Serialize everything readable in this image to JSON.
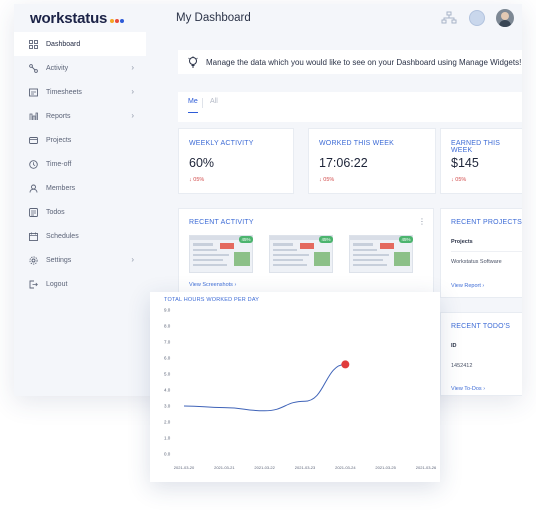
{
  "app": {
    "logo_text": "workstatus",
    "logo_dot_colors": [
      "#f5a623",
      "#e94b3c",
      "#2d5bd7"
    ],
    "page_title": "My Dashboard"
  },
  "sidebar": {
    "items": [
      {
        "label": "Dashboard",
        "icon": "dashboard-icon",
        "active": true,
        "chevron": false
      },
      {
        "label": "Activity",
        "icon": "activity-icon",
        "active": false,
        "chevron": true
      },
      {
        "label": "Timesheets",
        "icon": "timesheets-icon",
        "active": false,
        "chevron": true
      },
      {
        "label": "Reports",
        "icon": "reports-icon",
        "active": false,
        "chevron": true
      },
      {
        "label": "Projects",
        "icon": "projects-icon",
        "active": false,
        "chevron": false
      },
      {
        "label": "Time-off",
        "icon": "time-off-icon",
        "active": false,
        "chevron": false
      },
      {
        "label": "Members",
        "icon": "members-icon",
        "active": false,
        "chevron": false
      },
      {
        "label": "Todos",
        "icon": "todos-icon",
        "active": false,
        "chevron": false
      },
      {
        "label": "Schedules",
        "icon": "schedules-icon",
        "active": false,
        "chevron": false
      },
      {
        "label": "Settings",
        "icon": "settings-icon",
        "active": false,
        "chevron": true
      },
      {
        "label": "Logout",
        "icon": "logout-icon",
        "active": false,
        "chevron": false
      }
    ]
  },
  "banner": {
    "text": "Manage the data which you would like to see on your Dashboard using Manage Widgets!"
  },
  "tabs": {
    "me": "Me",
    "all": "All"
  },
  "stats": [
    {
      "label": "WEEKLY ACTIVITY",
      "value": "60%",
      "delta": "05%"
    },
    {
      "label": "WORKED THIS WEEK",
      "value": "17:06:22",
      "delta": "05%"
    },
    {
      "label": "EARNED THIS WEEK",
      "value": "$145",
      "delta": "05%"
    }
  ],
  "recent_activity": {
    "title": "RECENT ACTIVITY",
    "badges": [
      "45%",
      "45%",
      "45%"
    ],
    "view_link": "View Screenshots"
  },
  "recent_projects": {
    "title": "RECENT PROJECTS",
    "column": "Projects",
    "row": "Workstatus Software",
    "view_link": "View Report"
  },
  "recent_todos": {
    "title": "RECENT TODO'S",
    "column": "ID",
    "row": "1452412",
    "view_link": "View To-Dos"
  },
  "chart_data": {
    "type": "line",
    "title": "TOTAL HOURS WORKED PER DAY",
    "xlabel": "",
    "ylabel": "",
    "x": [
      "2021-03-20",
      "2021-03-21",
      "2021-03-22",
      "2021-03-23",
      "2021-03-24",
      "2021-03-25",
      "2021-03-26"
    ],
    "y_ticks": [
      "0.0",
      "1.0",
      "2.0",
      "3.0",
      "4.0",
      "5.0",
      "6.0",
      "7.0",
      "8.0",
      "9.0"
    ],
    "ylim": [
      0,
      9
    ],
    "series": [
      {
        "values": [
          3.0,
          2.9,
          2.7,
          3.3,
          5.6
        ],
        "color": "#3f63b8"
      }
    ],
    "highlight": {
      "x": "2021-03-24",
      "y": 5.6,
      "color": "#e03c3c"
    },
    "grid": false
  }
}
